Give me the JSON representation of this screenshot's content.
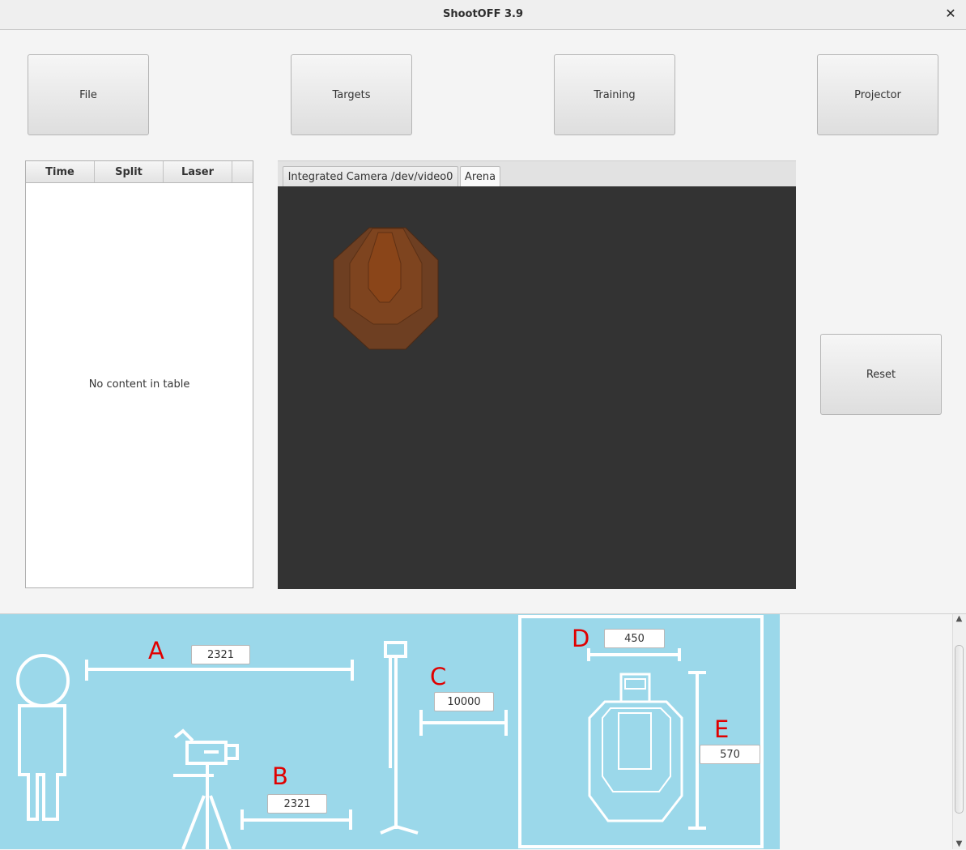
{
  "window": {
    "title": "ShootOFF 3.9"
  },
  "toolbar": {
    "file": "File",
    "targets": "Targets",
    "training": "Training",
    "projector": "Projector"
  },
  "shot_table": {
    "columns": [
      "Time",
      "Split",
      "Laser"
    ],
    "empty_message": "No content in table"
  },
  "tabs": [
    {
      "label": "Integrated Camera /dev/video0",
      "active": false
    },
    {
      "label": "Arena",
      "active": true
    }
  ],
  "reset_label": "Reset",
  "calibration": {
    "labels": {
      "a": "A",
      "b": "B",
      "c": "C",
      "d": "D",
      "e": "E"
    },
    "values": {
      "a": "2321",
      "b": "2321",
      "c": "10000",
      "d": "450",
      "e": "570"
    },
    "colors": {
      "panel": "#9bd8ea",
      "letter": "#e00000"
    }
  }
}
